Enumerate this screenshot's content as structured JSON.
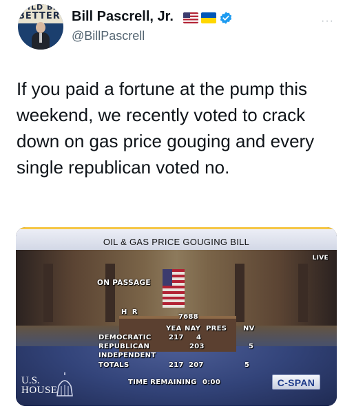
{
  "tweet": {
    "display_name": "Bill Pascrell, Jr.",
    "handle": "@BillPascrell",
    "avatar_banner_line1": "UILD BA",
    "avatar_banner_line2": "BETTER",
    "icons": [
      "us-flag-icon",
      "ukraine-flag-icon",
      "verified-badge-icon",
      "more-options-icon"
    ],
    "more_label": "···",
    "text": "If you paid a fortune at the pump this weekend, we recently voted to crack down on gas price gouging and every single republican voted no."
  },
  "media": {
    "bill_title": "OIL & GAS PRICE GOUGING BILL",
    "live_label": "LIVE",
    "vote_stage": "ON PASSAGE",
    "bill_prefix": "H R",
    "bill_number": "7688",
    "columns": {
      "yea": "YEA",
      "nay": "NAY",
      "pres": "PRES",
      "nv": "NV"
    },
    "rows": {
      "democratic": {
        "label": "DEMOCRATIC",
        "yea": "217",
        "nay": "4"
      },
      "republican": {
        "label": "REPUBLICAN",
        "nay": "203",
        "nv": "5"
      },
      "independent": {
        "label": "INDEPENDENT"
      },
      "totals": {
        "label": "TOTALS",
        "yea": "217",
        "nay": "207",
        "nv": "5"
      }
    },
    "time_label": "TIME REMAINING",
    "time_value": "0:00",
    "house_logo_line1": "U.S.",
    "house_logo_line2": "HOUSE",
    "network_logo": "C-SPAN"
  },
  "colors": {
    "text_primary": "#0f1419",
    "text_secondary": "#536471",
    "verified_blue": "#1d9bf0",
    "cspan_blue": "#1d3a8a"
  }
}
